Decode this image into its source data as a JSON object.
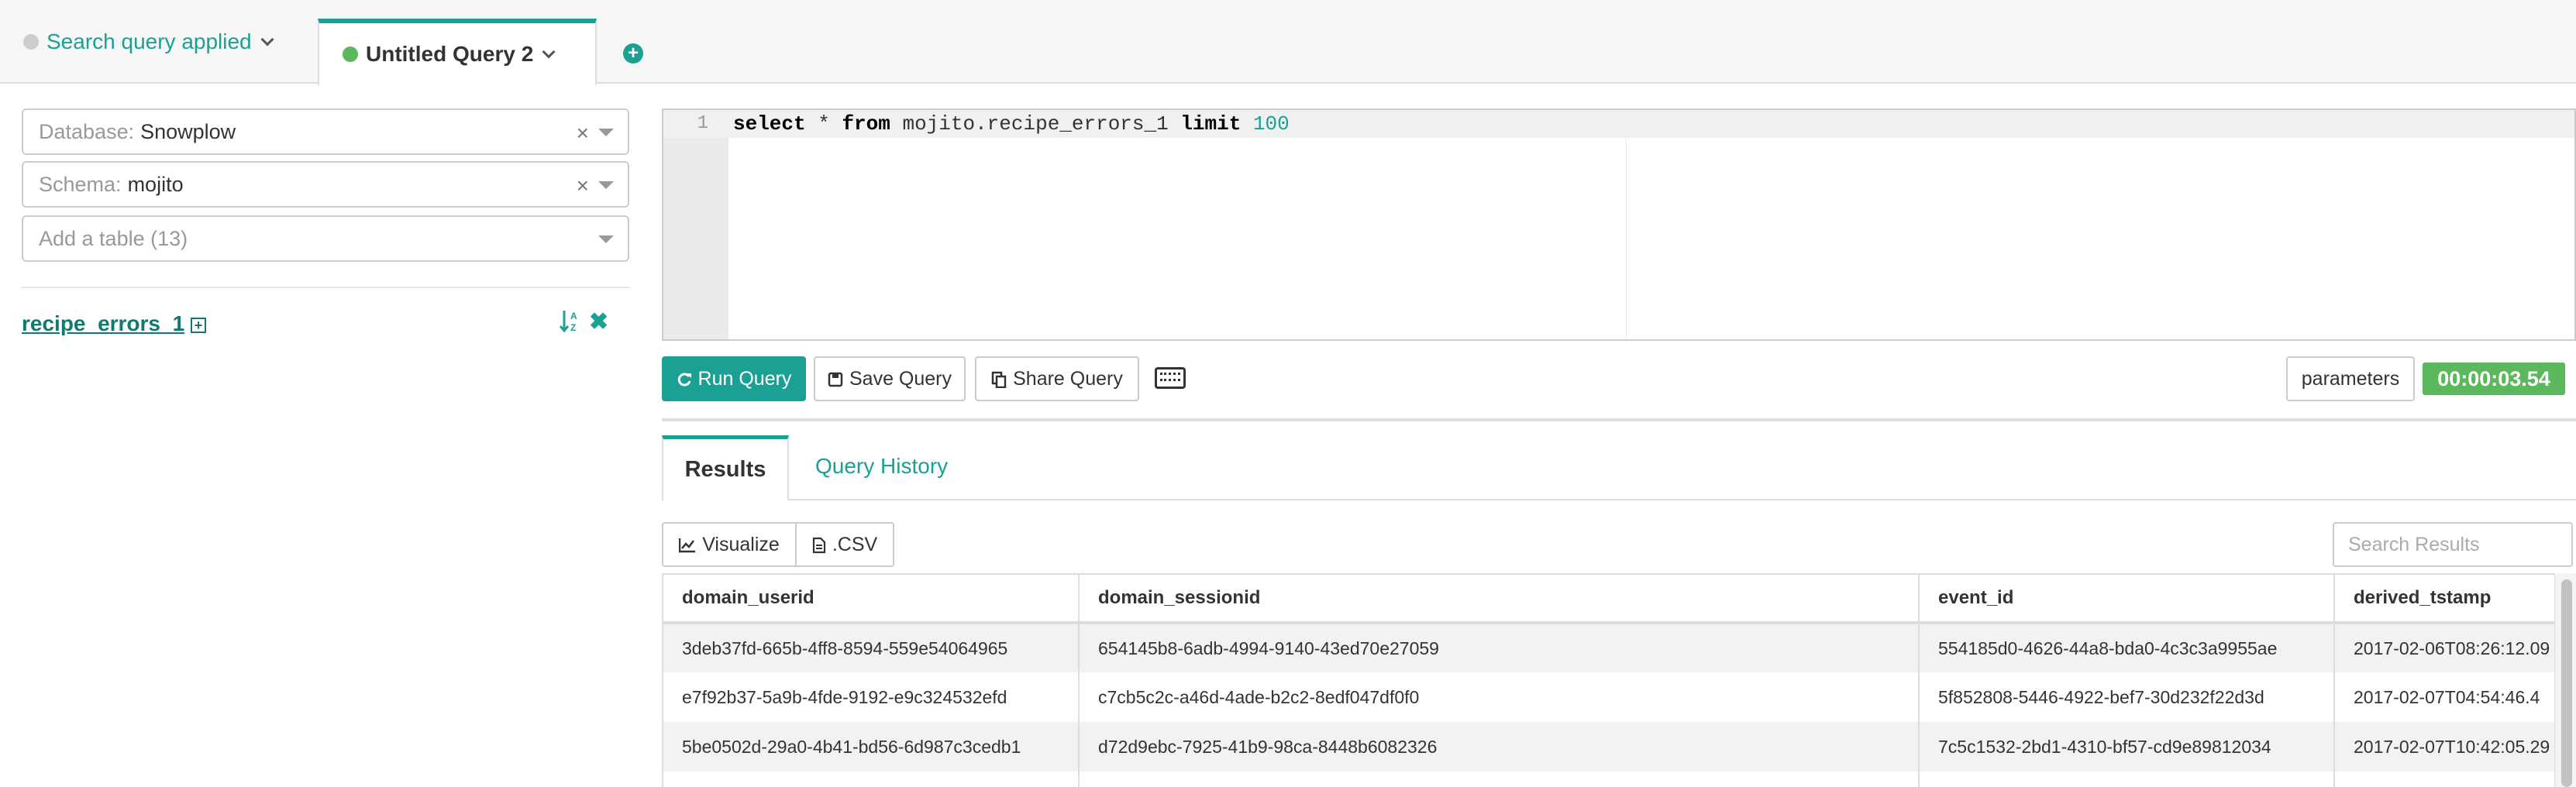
{
  "query_tabs": [
    {
      "label": "Search query applied",
      "status": "grey"
    },
    {
      "label": "Untitled Query 2",
      "status": "green",
      "active": true
    }
  ],
  "sidebar": {
    "database": {
      "label": "Database:",
      "value": "Snowplow"
    },
    "schema": {
      "label": "Schema:",
      "value": "mojito"
    },
    "add_table": {
      "placeholder": "Add a table (13)"
    },
    "selected_table": "recipe_errors_1"
  },
  "editor": {
    "line_number": "1",
    "tokens": {
      "kw1": "select",
      "t1": " * ",
      "kw2": "from",
      "t2": " mojito.recipe_errors_1 ",
      "kw3": "limit",
      "t3": " ",
      "num": "100"
    }
  },
  "toolbar": {
    "run_label": "Run Query",
    "save_label": "Save Query",
    "share_label": "Share Query",
    "parameters_label": "parameters",
    "timer": "00:00:03.54"
  },
  "results_tabs": {
    "results": "Results",
    "history": "Query History"
  },
  "results_toolbar": {
    "visualize": "Visualize",
    "csv": ".CSV",
    "search_placeholder": "Search Results"
  },
  "table": {
    "columns": [
      "domain_userid",
      "domain_sessionid",
      "event_id",
      "derived_tstamp"
    ],
    "rows": [
      [
        "3deb37fd-665b-4ff8-8594-559e54064965",
        "654145b8-6adb-4994-9140-43ed70e27059",
        "554185d0-4626-44a8-bda0-4c3c3a9955ae",
        "2017-02-06T08:26:12.09"
      ],
      [
        "e7f92b37-5a9b-4fde-9192-e9c324532efd",
        "c7cb5c2c-a46d-4ade-b2c2-8edf047df0f0",
        "5f852808-5446-4922-bef7-30d232f22d3d",
        "2017-02-07T04:54:46.4"
      ],
      [
        "5be0502d-29a0-4b41-bd56-6d987c3cedb1",
        "d72d9ebc-7925-41b9-98ca-8448b6082326",
        "7c5c1532-2bd1-4310-bf57-cd9e89812034",
        "2017-02-07T10:42:05.29"
      ]
    ]
  },
  "colors": {
    "accent": "#1aa194",
    "success": "#5cb85c",
    "link_dark": "#117a70"
  }
}
